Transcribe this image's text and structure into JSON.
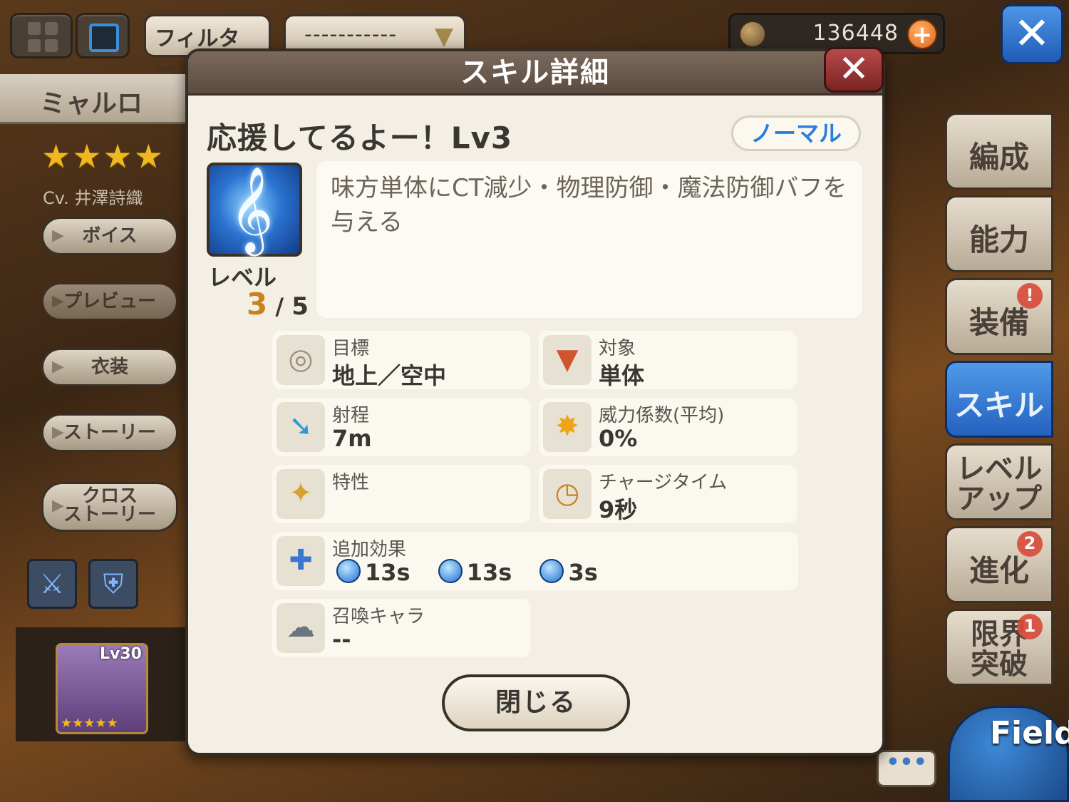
{
  "topbar": {
    "filter_label": "フィルター",
    "dropdown_value": "-----------",
    "currency_amount": "136448",
    "currency_plus": "+",
    "close_glyph": "✕"
  },
  "character": {
    "name": "ミャルロ",
    "stars": "★★★★",
    "cv": "Cv. 井澤詩織",
    "buttons": {
      "voice": "ボイス",
      "preview": "プレビュー",
      "costume": "衣装",
      "story": "ストーリー",
      "cross_line1": "クロス",
      "cross_line2": "ストーリー"
    },
    "portrait_level": "Lv30",
    "portrait_stars": "★★★★★"
  },
  "right_tabs": {
    "formation": "編成",
    "ability": "能力",
    "equip": "装備",
    "equip_badge": "!",
    "skill": "スキル",
    "levelup_line1": "レベル",
    "levelup_line2": "アップ",
    "evolve": "進化",
    "evolve_badge": "2",
    "limit_line1": "限界",
    "limit_line2": "突破",
    "limit_badge": "1"
  },
  "field_label": "Field",
  "chat_label": "•••",
  "modal": {
    "title": "スキル詳細",
    "close_glyph": "✕",
    "skill_name": "応援してるよー！Lv3",
    "skill_type": "ノーマル",
    "level_label": "レベル",
    "level_current": "3",
    "level_sep": " / ",
    "level_max": "5",
    "description": "味方単体にCT減少・物理防御・魔法防御バフを与える",
    "stats": {
      "target_label": "目標",
      "target_value": "地上／空中",
      "object_label": "対象",
      "object_value": "単体",
      "range_label": "射程",
      "range_value": "7m",
      "power_label": "威力係数(平均)",
      "power_value": "0%",
      "trait_label": "特性",
      "trait_value": "",
      "charge_label": "チャージタイム",
      "charge_value": "9秒",
      "effects_label": "追加効果",
      "effects": [
        "13s",
        "13s",
        "3s"
      ],
      "summon_label": "召喚キャラ",
      "summon_value": "--"
    },
    "close_button": "閉じる"
  },
  "icons": {
    "target": "crosshair-icon",
    "object": "single-target-icon",
    "range": "arrow-range-icon",
    "power": "burst-icon",
    "trait": "sword-sparkle-icon",
    "charge": "clock-icon",
    "effects": "sword-plus-icon",
    "summon": "summon-creature-icon"
  },
  "colors": {
    "accent_blue": "#2b7fdc",
    "level_orange": "#c8831e",
    "modal_bg": "#f3efe4",
    "header_bg": "#6b5a4c",
    "active_tab": "#2f72d0"
  }
}
